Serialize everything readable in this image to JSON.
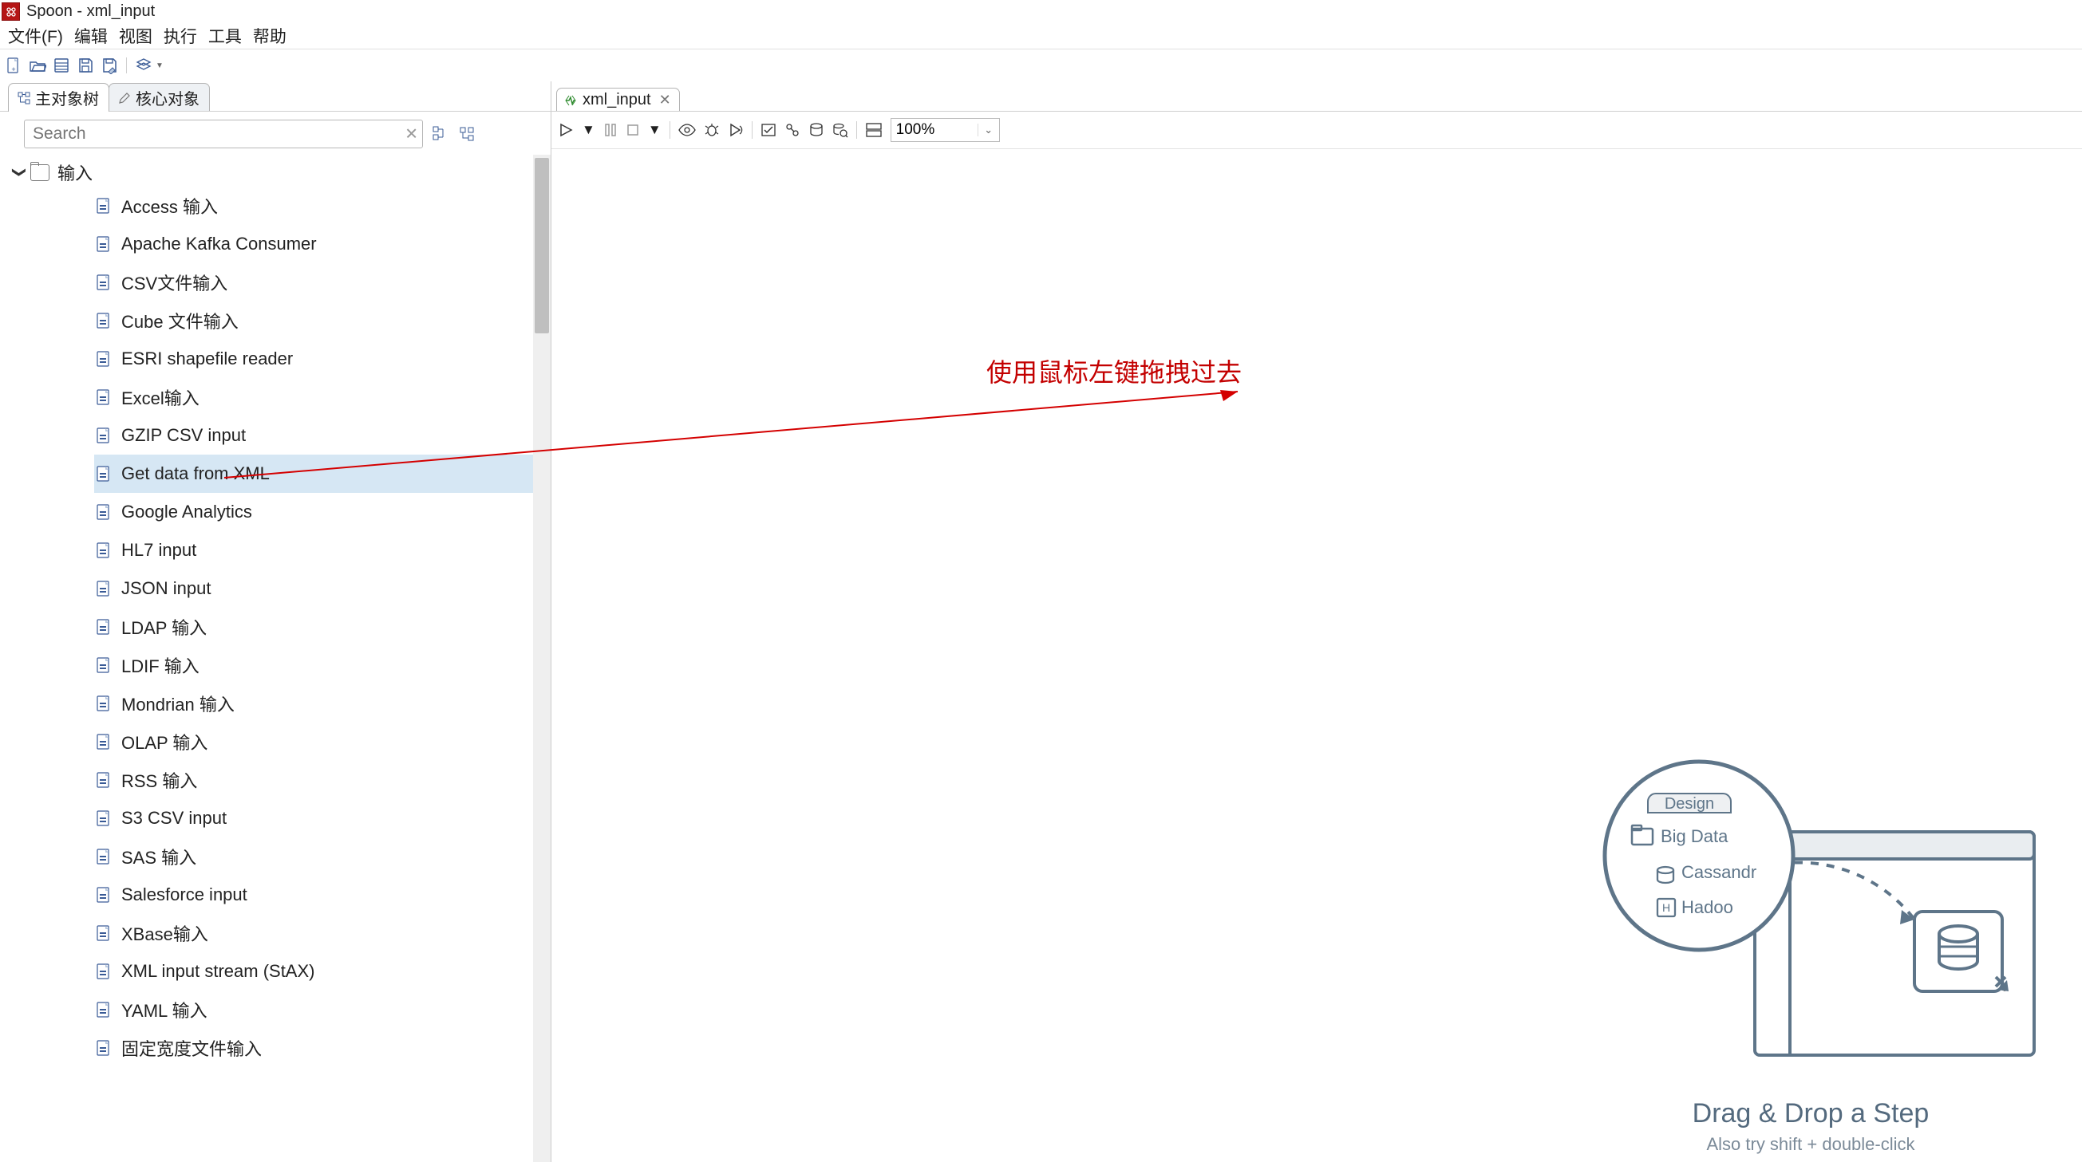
{
  "window": {
    "title": "Spoon - xml_input"
  },
  "menubar": {
    "items": [
      "文件(F)",
      "编辑",
      "视图",
      "执行",
      "工具",
      "帮助"
    ]
  },
  "toolbar": {
    "buttons": [
      "new",
      "open",
      "explore",
      "save",
      "saveas",
      "sep",
      "perspective",
      "perspective-menu"
    ]
  },
  "left_tabs": {
    "items": [
      {
        "id": "tree",
        "label": "主对象树",
        "icon": "tree-icon",
        "active": true
      },
      {
        "id": "core",
        "label": "核心对象",
        "icon": "pencil-icon",
        "active": false
      }
    ]
  },
  "search": {
    "placeholder": "Search",
    "value": "",
    "actions": [
      "expand-all",
      "collapse-all"
    ]
  },
  "tree": {
    "folder": {
      "label": "输入",
      "expanded": true
    },
    "items": [
      {
        "label": "Access 输入",
        "selected": false
      },
      {
        "label": "Apache Kafka Consumer",
        "selected": false
      },
      {
        "label": "CSV文件输入",
        "selected": false
      },
      {
        "label": "Cube 文件输入",
        "selected": false
      },
      {
        "label": "ESRI shapefile reader",
        "selected": false
      },
      {
        "label": "Excel输入",
        "selected": false
      },
      {
        "label": "GZIP CSV input",
        "selected": false
      },
      {
        "label": "Get data from XML",
        "selected": true
      },
      {
        "label": "Google Analytics",
        "selected": false
      },
      {
        "label": "HL7 input",
        "selected": false
      },
      {
        "label": "JSON input",
        "selected": false
      },
      {
        "label": "LDAP 输入",
        "selected": false
      },
      {
        "label": "LDIF 输入",
        "selected": false
      },
      {
        "label": "Mondrian 输入",
        "selected": false
      },
      {
        "label": "OLAP 输入",
        "selected": false
      },
      {
        "label": "RSS 输入",
        "selected": false
      },
      {
        "label": "S3 CSV input",
        "selected": false
      },
      {
        "label": "SAS 输入",
        "selected": false
      },
      {
        "label": "Salesforce input",
        "selected": false
      },
      {
        "label": "XBase输入",
        "selected": false
      },
      {
        "label": "XML input stream (StAX)",
        "selected": false
      },
      {
        "label": "YAML 输入",
        "selected": false
      },
      {
        "label": "固定宽度文件输入",
        "selected": false
      }
    ]
  },
  "editor": {
    "tabs": [
      {
        "label": "xml_input",
        "icon": "transformation-icon",
        "active": true
      }
    ],
    "zoom": "100%"
  },
  "annotation": {
    "text": "使用鼠标左键拖拽过去"
  },
  "helper": {
    "caption1": "Drag & Drop a Step",
    "caption2": "Also try shift + double-click",
    "tab": "Design",
    "folder": "Big Data",
    "items": [
      "Cassandr",
      "Hadoo"
    ]
  }
}
